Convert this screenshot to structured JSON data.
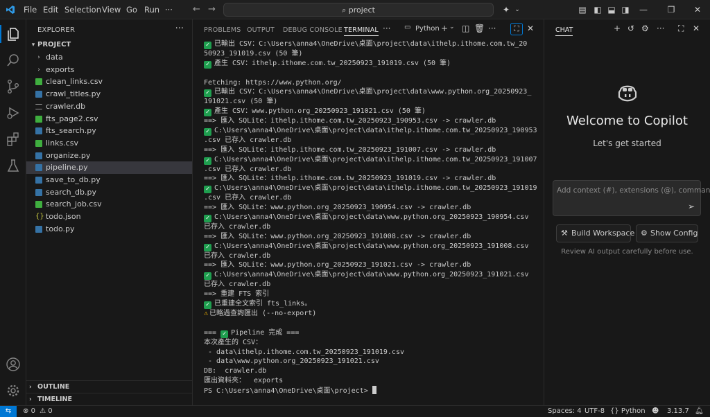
{
  "titlebar": {
    "menu": [
      "File",
      "Edit",
      "Selection",
      "View",
      "Go",
      "Run",
      "···"
    ],
    "search_text": "project"
  },
  "sidebar": {
    "header": "EXPLORER",
    "project": "PROJECT",
    "items": [
      {
        "label": "data",
        "kind": "folder"
      },
      {
        "label": "exports",
        "kind": "folder"
      },
      {
        "label": "clean_links.csv",
        "kind": "csv"
      },
      {
        "label": "crawl_titles.py",
        "kind": "py"
      },
      {
        "label": "crawler.db",
        "kind": "db"
      },
      {
        "label": "fts_page2.csv",
        "kind": "csv"
      },
      {
        "label": "fts_search.py",
        "kind": "py"
      },
      {
        "label": "links.csv",
        "kind": "csv"
      },
      {
        "label": "organize.py",
        "kind": "py"
      },
      {
        "label": "pipeline.py",
        "kind": "py",
        "selected": true
      },
      {
        "label": "save_to_db.py",
        "kind": "py"
      },
      {
        "label": "search_db.py",
        "kind": "py"
      },
      {
        "label": "search_job.csv",
        "kind": "csv"
      },
      {
        "label": "todo.json",
        "kind": "json"
      },
      {
        "label": "todo.py",
        "kind": "py"
      }
    ],
    "outline": "OUTLINE",
    "timeline": "TIMELINE"
  },
  "panel": {
    "tabs": [
      "PROBLEMS",
      "OUTPUT",
      "DEBUG CONSOLE",
      "TERMINAL"
    ],
    "active_tab": "TERMINAL",
    "terminal_profile": "Python",
    "lines": [
      {
        "ok": true,
        "text": "已輸出 CSV：C:\\Users\\anna4\\OneDrive\\桌面\\project\\data\\ithelp.ithome.com.tw_20"
      },
      {
        "text": "50923_191019.csv (50 筆)"
      },
      {
        "ok": true,
        "text": "產生 CSV：ithelp.ithome.com.tw_20250923_191019.csv (50 筆)"
      },
      {
        "text": ""
      },
      {
        "text": "Fetching: https://www.python.org/"
      },
      {
        "ok": true,
        "text": "已輸出 CSV：C:\\Users\\anna4\\OneDrive\\桌面\\project\\data\\www.python.org_20250923_"
      },
      {
        "text": "191021.csv (50 筆)"
      },
      {
        "ok": true,
        "text": "產生 CSV：www.python.org_20250923_191021.csv (50 筆)"
      },
      {
        "text": "==> 匯入 SQLite：ithelp.ithome.com.tw_20250923_190953.csv -> crawler.db"
      },
      {
        "ok": true,
        "text": "C:\\Users\\anna4\\OneDrive\\桌面\\project\\data\\ithelp.ithome.com.tw_20250923_190953"
      },
      {
        "text": ".csv 已存入 crawler.db"
      },
      {
        "text": "==> 匯入 SQLite：ithelp.ithome.com.tw_20250923_191007.csv -> crawler.db"
      },
      {
        "ok": true,
        "text": "C:\\Users\\anna4\\OneDrive\\桌面\\project\\data\\ithelp.ithome.com.tw_20250923_191007"
      },
      {
        "text": ".csv 已存入 crawler.db"
      },
      {
        "text": "==> 匯入 SQLite：ithelp.ithome.com.tw_20250923_191019.csv -> crawler.db"
      },
      {
        "ok": true,
        "text": "C:\\Users\\anna4\\OneDrive\\桌面\\project\\data\\ithelp.ithome.com.tw_20250923_191019"
      },
      {
        "text": ".csv 已存入 crawler.db"
      },
      {
        "text": "==> 匯入 SQLite：www.python.org_20250923_190954.csv -> crawler.db"
      },
      {
        "ok": true,
        "text": "C:\\Users\\anna4\\OneDrive\\桌面\\project\\data\\www.python.org_20250923_190954.csv"
      },
      {
        "text": "已存入 crawler.db"
      },
      {
        "text": "==> 匯入 SQLite：www.python.org_20250923_191008.csv -> crawler.db"
      },
      {
        "ok": true,
        "text": "C:\\Users\\anna4\\OneDrive\\桌面\\project\\data\\www.python.org_20250923_191008.csv"
      },
      {
        "text": "已存入 crawler.db"
      },
      {
        "text": "==> 匯入 SQLite：www.python.org_20250923_191021.csv -> crawler.db"
      },
      {
        "ok": true,
        "text": "C:\\Users\\anna4\\OneDrive\\桌面\\project\\data\\www.python.org_20250923_191021.csv"
      },
      {
        "text": "已存入 crawler.db"
      },
      {
        "text": "==> 重建 FTS 索引"
      },
      {
        "ok": true,
        "text": "已重建全文索引 fts_links。"
      },
      {
        "warn": true,
        "text": "已略過查詢匯出 (--no-export)"
      },
      {
        "text": ""
      },
      {
        "text": "=== ",
        "ok_inline": true,
        "after": "Pipeline 完成 ==="
      },
      {
        "text": "本次產生的 CSV："
      },
      {
        "text": " - data\\ithelp.ithome.com.tw_20250923_191019.csv"
      },
      {
        "text": " - data\\www.python.org_20250923_191021.csv"
      },
      {
        "text": "DB:  crawler.db"
      },
      {
        "text": "匯出資料夾：  exports"
      },
      {
        "text": "PS C:\\Users\\anna4\\OneDrive\\桌面\\project> ",
        "cursor": true
      }
    ]
  },
  "chat": {
    "title": "CHAT",
    "welcome": "Welcome to Copilot",
    "subtitle": "Let's get started",
    "input_placeholder": "Add context (#), extensions (@), commands",
    "build_workspace": "Build Workspace",
    "show_config": "Show Config",
    "review_note": "Review AI output carefully before use."
  },
  "statusbar": {
    "errors": "0",
    "warnings": "0",
    "spaces": "Spaces: 4",
    "encoding": "UTF-8",
    "language": "Python",
    "version": "3.13.7"
  }
}
